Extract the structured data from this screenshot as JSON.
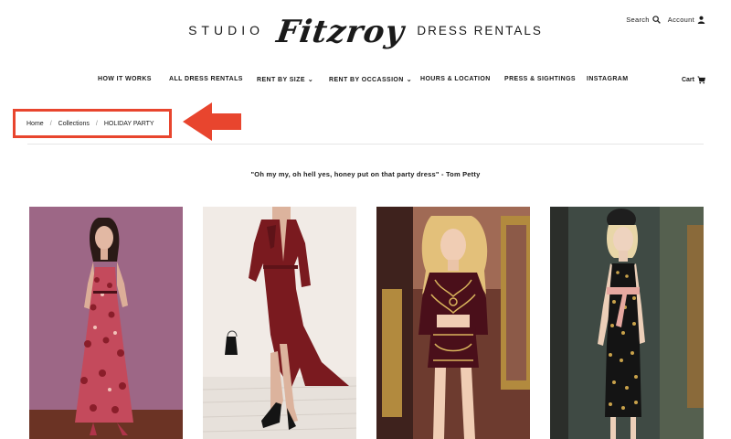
{
  "header": {
    "search_label": "Search",
    "account_label": "Account",
    "logo_left": "STUDIO",
    "logo_script": "Fitzroy",
    "logo_right": "DRESS RENTALS"
  },
  "nav": {
    "items": [
      {
        "label": "HOW IT WORKS",
        "dropdown": false
      },
      {
        "label": "ALL DRESS RENTALS",
        "dropdown": false
      },
      {
        "label": "RENT BY SIZE",
        "dropdown": true
      },
      {
        "label": "RENT BY OCCASSION",
        "dropdown": true
      },
      {
        "label": "HOURS & LOCATION",
        "dropdown": false
      },
      {
        "label": "PRESS & SIGHTINGS",
        "dropdown": false
      },
      {
        "label": "INSTAGRAM",
        "dropdown": false
      }
    ],
    "cart_label": "Cart"
  },
  "breadcrumb": {
    "home": "Home",
    "collections": "Collections",
    "current": "HOLIDAY PARTY",
    "separator": "/",
    "highlight_color": "#e8452e"
  },
  "quote": "\"Oh my my, oh hell yes, honey put on that party dress\" - Tom Petty",
  "products": [
    {
      "icon": "floral-maxi-dress-photo"
    },
    {
      "icon": "red-velvet-wrap-dress-photo"
    },
    {
      "icon": "embroidered-velvet-set-photo"
    },
    {
      "icon": "polka-dot-slip-dress-photo"
    }
  ]
}
